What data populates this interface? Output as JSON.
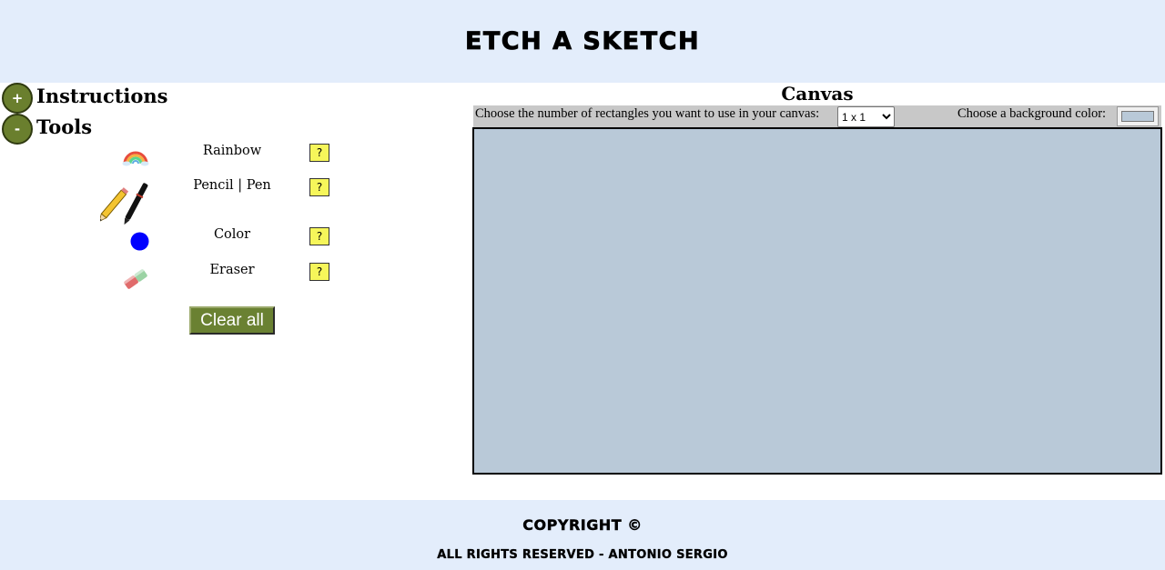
{
  "header": {
    "title": "ETCH A SKETCH"
  },
  "sections": {
    "instructions": {
      "toggle": "+",
      "label": "Instructions"
    },
    "tools": {
      "toggle": "-",
      "label": "Tools"
    }
  },
  "tools": {
    "rainbow": {
      "label": "Rainbow",
      "help": "?"
    },
    "pencil_pen": {
      "label": "Pencil | Pen",
      "help": "?"
    },
    "color": {
      "label": "Color",
      "help": "?",
      "swatch_color": "#0000ff"
    },
    "eraser": {
      "label": "Eraser",
      "help": "?"
    },
    "clear_all": "Clear all"
  },
  "canvas": {
    "title": "Canvas",
    "rect_label": "Choose the number of rectangles you want to use in your canvas:",
    "rect_selected": "1 x 1",
    "bg_label": "Choose a background color:",
    "bg_color": "#b9c9d8"
  },
  "footer": {
    "copyright": "COPYRIGHT ©",
    "rights": "ALL RIGHTS RESERVED - ANTONIO SERGIO"
  }
}
